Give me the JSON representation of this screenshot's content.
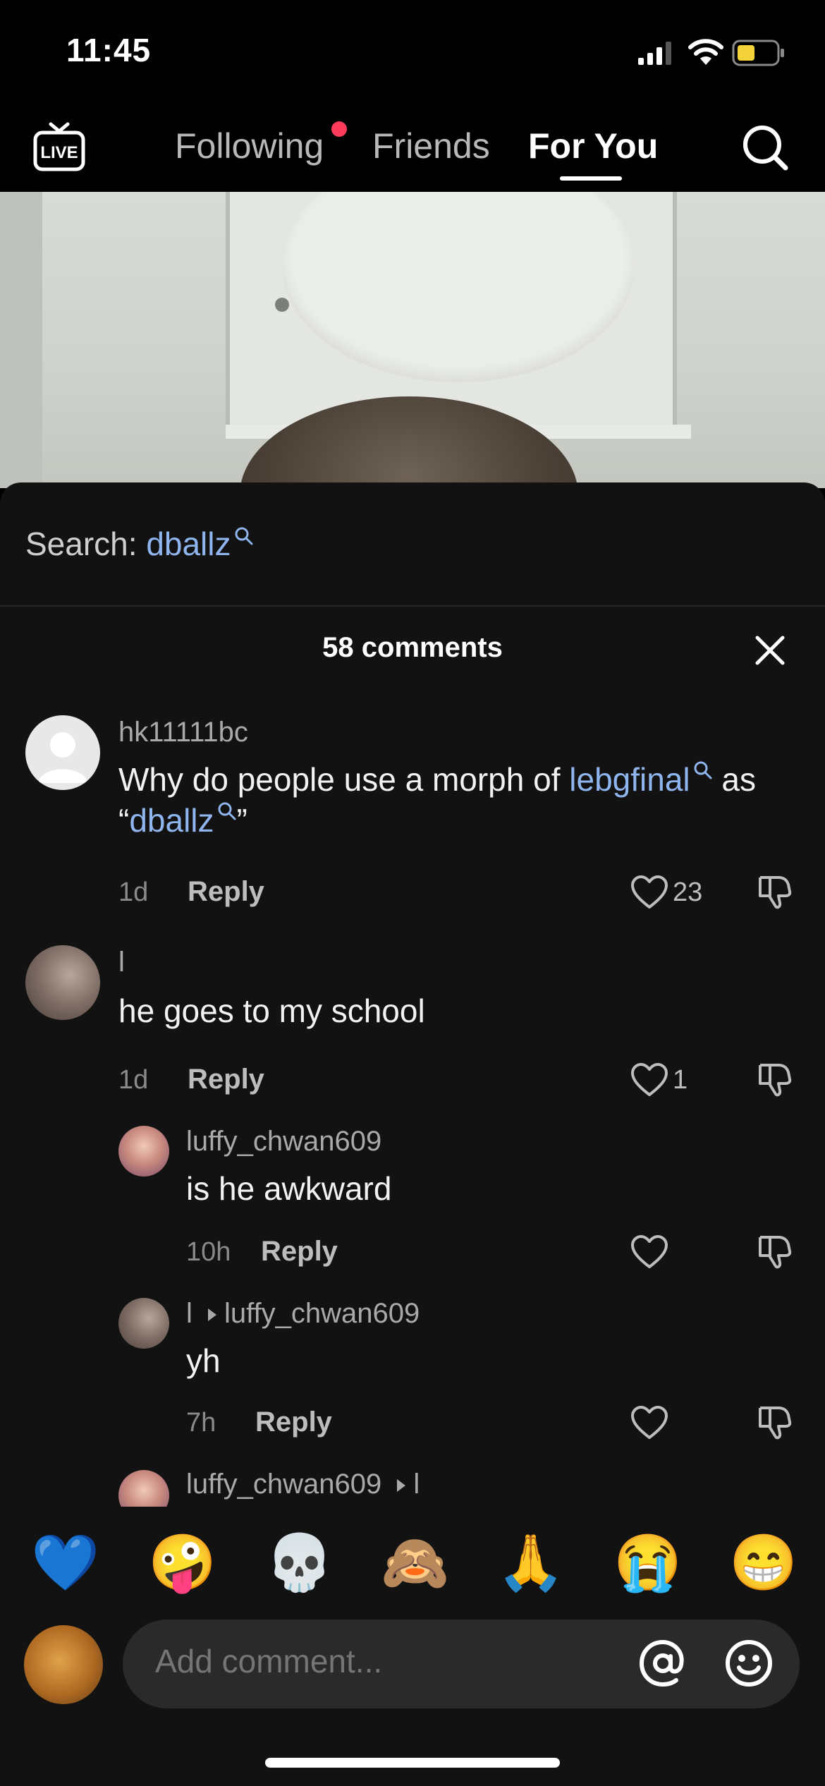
{
  "status_bar": {
    "time": "11:45"
  },
  "nav": {
    "live_label": "LIVE",
    "tabs": [
      {
        "label": "Following",
        "has_dot": true
      },
      {
        "label": "Friends"
      },
      {
        "label": "For You",
        "active": true
      }
    ]
  },
  "sheet": {
    "search_prefix": "Search:",
    "search_term": "dballz",
    "comment_count": "58 comments",
    "comments": [
      {
        "username": "hk11111bc",
        "text_before": "Why do people use a morph of ",
        "link1": "lebgfinal",
        "text_middle": " as",
        "text_line2_prefix": "“",
        "link2": "dballz",
        "text_line2_suffix": "”",
        "time": "1d",
        "reply": "Reply",
        "likes": "23"
      },
      {
        "username": "l",
        "text": "he goes to my school",
        "time": "1d",
        "reply": "Reply",
        "likes": "1"
      },
      {
        "username": "luffy_chwan609",
        "text": "is he awkward",
        "time": "10h",
        "reply": "Reply",
        "likes": ""
      },
      {
        "username": "l",
        "reply_to": "luffy_chwan609",
        "text": "yh",
        "time": "7h",
        "reply": "Reply",
        "likes": ""
      },
      {
        "username": "luffy_chwan609",
        "reply_to": "l"
      }
    ]
  },
  "emoji_bar": [
    "💙",
    "🤪",
    "💀",
    "🙈",
    "🙏",
    "😭",
    "😁"
  ],
  "input": {
    "placeholder": "Add comment..."
  },
  "colors": {
    "accent_link": "#8fb5ee",
    "notification_dot": "#ff3b5c",
    "sheet_bg": "#121212"
  }
}
